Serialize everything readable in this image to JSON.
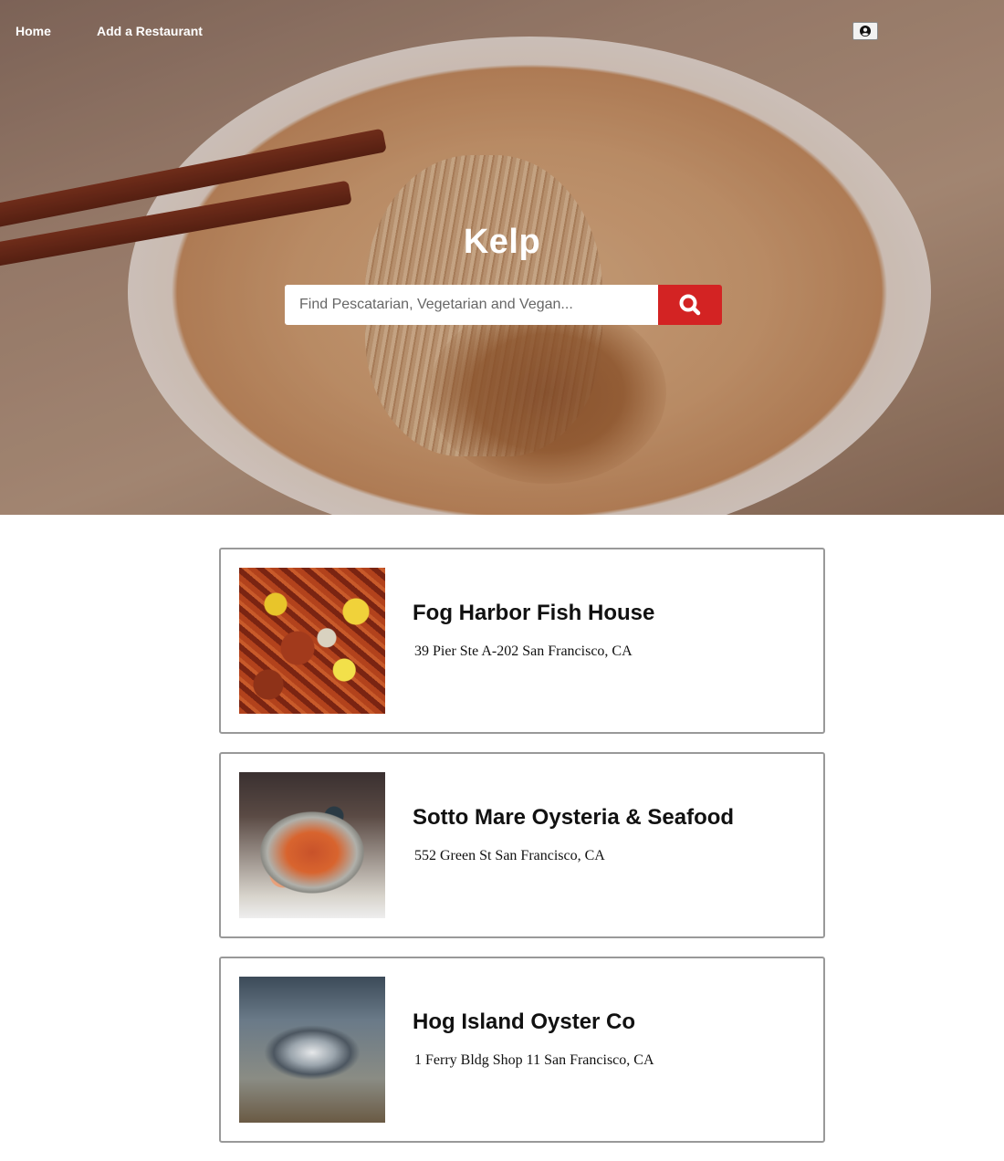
{
  "nav": {
    "home_label": "Home",
    "add_label": "Add a Restaurant",
    "user_icon": "user-circle-icon"
  },
  "hero": {
    "brand": "Kelp",
    "search": {
      "placeholder": "Find Pescatarian, Vegetarian and Vegan...",
      "value": "",
      "button_icon": "search-icon"
    }
  },
  "colors": {
    "accent": "#d32323",
    "card_border": "#999999",
    "text": "#111111"
  },
  "restaurants": [
    {
      "name": "Fog Harbor Fish House",
      "address": "39 Pier Ste A-202 San Francisco, CA"
    },
    {
      "name": "Sotto Mare Oysteria & Seafood",
      "address": "552 Green St San Francisco, CA"
    },
    {
      "name": "Hog Island Oyster Co",
      "address": "1 Ferry Bldg Shop 11 San Francisco, CA"
    }
  ]
}
